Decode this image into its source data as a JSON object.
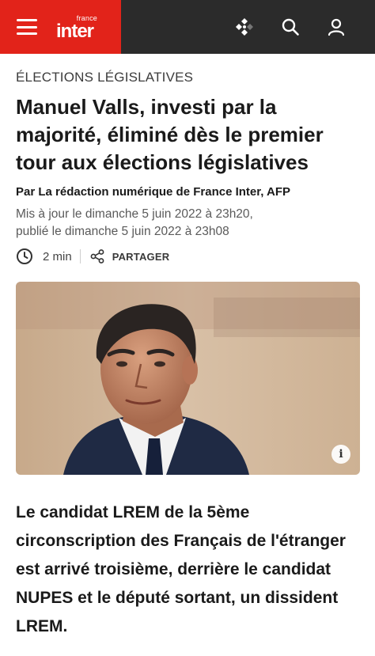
{
  "header": {
    "logo_small": "france",
    "logo_big": "inter",
    "menu_icon": "hamburger-menu-icon",
    "actions": [
      "radio-live-icon",
      "search-icon",
      "user-icon"
    ],
    "colors": {
      "brand_red": "#e2231a",
      "bar_dark": "#2b2b2b"
    }
  },
  "article": {
    "kicker": "ÉLECTIONS LÉGISLATIVES",
    "title": "Manuel Valls, investi par la majorité, éliminé dès le premier tour aux élections législatives",
    "byline": "Par La rédaction numérique de France Inter, AFP",
    "updated": "Mis à jour le dimanche 5 juin 2022 à 23h20,",
    "published": "publié le dimanche 5 juin 2022 à 23h08",
    "reading_time": "2 min",
    "share_label": "PARTAGER",
    "photo_info_label": "i",
    "lead": "Le candidat LREM de la 5ème circonscription des Français de l'étranger est arrivé troisième, derrière le candidat NUPES et le député sortant, un dissident LREM."
  }
}
